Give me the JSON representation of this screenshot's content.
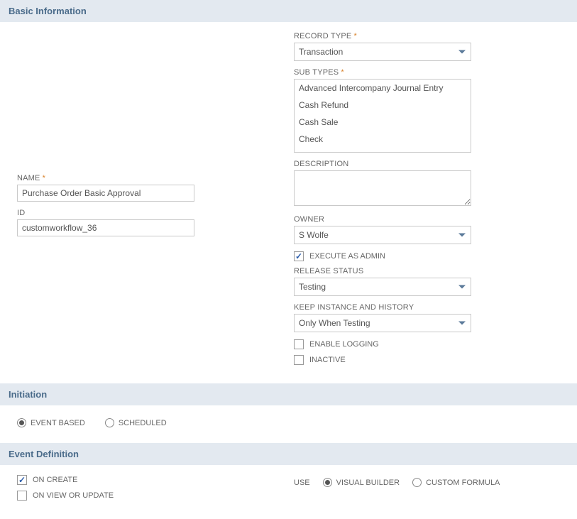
{
  "sections": {
    "basic_info_title": "Basic Information",
    "initiation_title": "Initiation",
    "event_def_title": "Event Definition"
  },
  "left": {
    "name_label": "NAME",
    "name_value": "Purchase Order Basic Approval",
    "id_label": "ID",
    "id_value": "customworkflow_36"
  },
  "right": {
    "record_type_label": "RECORD TYPE",
    "record_type_value": "Transaction",
    "sub_types_label": "SUB TYPES",
    "sub_types": [
      "Advanced Intercompany Journal Entry",
      "Cash Refund",
      "Cash Sale",
      "Check"
    ],
    "description_label": "DESCRIPTION",
    "description_value": "",
    "owner_label": "OWNER",
    "owner_value": "S Wolfe",
    "execute_admin_label": "EXECUTE AS ADMIN",
    "release_status_label": "RELEASE STATUS",
    "release_status_value": "Testing",
    "keep_instance_label": "KEEP INSTANCE AND HISTORY",
    "keep_instance_value": "Only When Testing",
    "enable_logging_label": "ENABLE LOGGING",
    "inactive_label": "INACTIVE"
  },
  "initiation": {
    "event_based_label": "EVENT BASED",
    "scheduled_label": "SCHEDULED"
  },
  "event_def": {
    "on_create_label": "ON CREATE",
    "on_view_update_label": "ON VIEW OR UPDATE",
    "use_label": "USE",
    "visual_builder_label": "VISUAL BUILDER",
    "custom_formula_label": "CUSTOM FORMULA"
  }
}
